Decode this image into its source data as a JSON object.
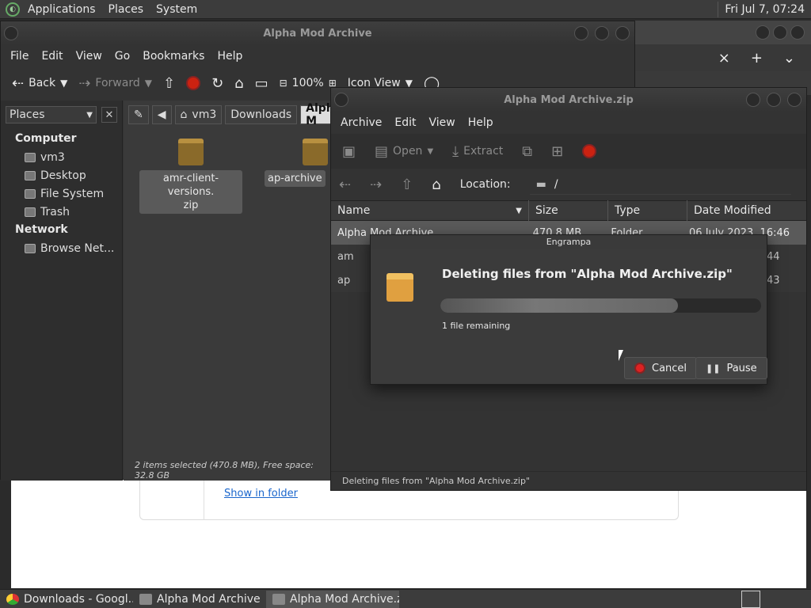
{
  "top_panel": {
    "menus": [
      "Applications",
      "Places",
      "System"
    ],
    "clock": "Fri Jul  7, 07:24"
  },
  "browser": {
    "tab_close": "×",
    "tab_new": "+",
    "tab_menu": "⌄",
    "download_link": "Show in folder"
  },
  "caja": {
    "title": "Alpha Mod Archive",
    "menu": [
      "File",
      "Edit",
      "View",
      "Go",
      "Bookmarks",
      "Help"
    ],
    "toolbar": {
      "back": "Back",
      "forward": "Forward",
      "zoom": "100%",
      "view_mode": "Icon View"
    },
    "sidebar": {
      "combo": "Places",
      "sections": [
        {
          "title": "Computer",
          "items": [
            "vm3",
            "Desktop",
            "File System",
            "Trash"
          ]
        },
        {
          "title": "Network",
          "items": [
            "Browse Net..."
          ]
        }
      ]
    },
    "path": [
      "vm3",
      "Downloads",
      "Alpha M"
    ],
    "files": [
      {
        "name_line1": "amr-client-versions.",
        "name_line2": "zip"
      },
      {
        "name_line1": "ap-archive",
        "name_line2": ""
      }
    ],
    "status": "2 items selected (470.8 MB), Free space: 32.8 GB"
  },
  "engrampa": {
    "title": "Alpha Mod Archive.zip",
    "menu": [
      "Archive",
      "Edit",
      "View",
      "Help"
    ],
    "toolbar": {
      "open": "Open",
      "extract": "Extract"
    },
    "location_label": "Location:",
    "location_value": "/",
    "columns": [
      "Name",
      "Size",
      "Type",
      "Date Modified"
    ],
    "rows": [
      {
        "name": "Alpha Mod Archive",
        "size": "470.8 MB",
        "type": "Folder",
        "date": "06 July 2023, 16:46"
      },
      {
        "name": "am",
        "size": "",
        "type": "",
        "date": "44"
      },
      {
        "name": "ap",
        "size": "",
        "type": "",
        "date": "43"
      }
    ],
    "status": "Deleting files from \"Alpha Mod Archive.zip\""
  },
  "dialog": {
    "title": "Engrampa",
    "heading": "Deleting files from \"Alpha Mod Archive.zip\"",
    "progress": 0.74,
    "remaining": "1 file remaining",
    "cancel": "Cancel",
    "pause": "Pause"
  },
  "taskbar": {
    "tasks": [
      "Downloads - Googl...",
      "Alpha Mod Archive",
      "Alpha Mod Archive.zip"
    ]
  }
}
